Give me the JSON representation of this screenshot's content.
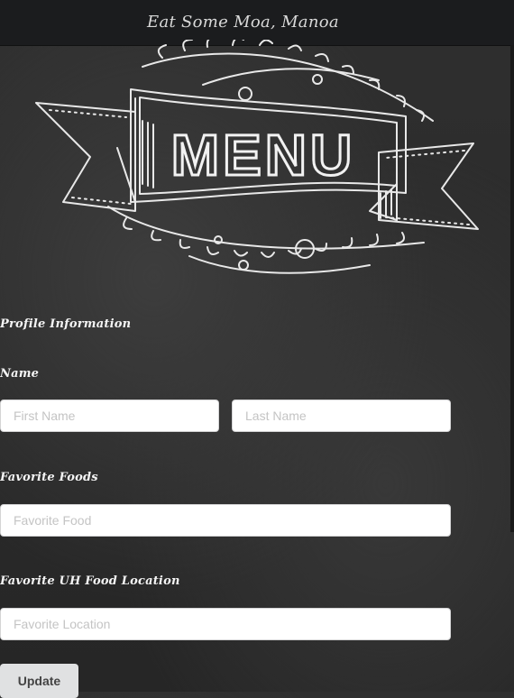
{
  "navbar": {
    "brand": "Eat Some Moa, Manoa"
  },
  "banner": {
    "text": "MENU"
  },
  "form": {
    "section_title": "Profile Information",
    "name_label": "Name",
    "first_name_placeholder": "First Name",
    "last_name_placeholder": "Last Name",
    "foods_label": "Favorite Foods",
    "food_placeholder": "Favorite Food",
    "location_label": "Favorite UH Food Location",
    "location_placeholder": "Favorite Location",
    "update_label": "Update"
  },
  "colors": {
    "navbar_bg": "#1b1c1e",
    "chalkboard_bg": "#2b2b2b",
    "chalk": "#efefef",
    "button_bg": "#e0e1e2"
  }
}
